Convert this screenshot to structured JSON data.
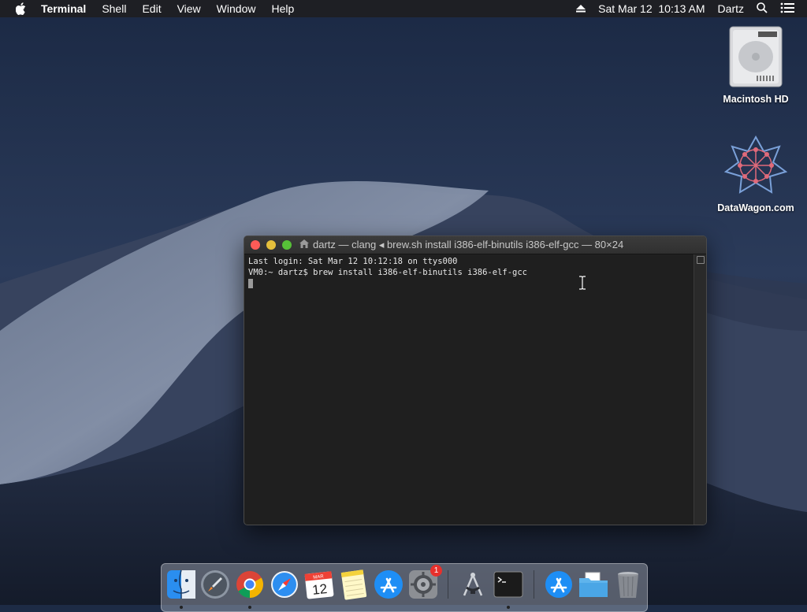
{
  "menubar": {
    "app_name": "Terminal",
    "items": [
      "Shell",
      "Edit",
      "View",
      "Window",
      "Help"
    ],
    "datetime": "Sat Mar 12  10:13 AM",
    "user": "Dartz"
  },
  "desktop_icons": [
    {
      "label": "Macintosh HD",
      "icon": "hard-drive-icon"
    },
    {
      "label": "DataWagon.com",
      "icon": "datawagon-logo-icon"
    }
  ],
  "terminal": {
    "title": "dartz — clang ◂ brew.sh install i386-elf-binutils i386-elf-gcc — 80×24",
    "lines": [
      "Last login: Sat Mar 12 10:12:18 on ttys000",
      "VM0:~ dartz$ brew install i386-elf-binutils i386-elf-gcc"
    ]
  },
  "dock": {
    "items": [
      {
        "name": "finder",
        "running": true
      },
      {
        "name": "launchpad",
        "running": false
      },
      {
        "name": "chrome",
        "running": true
      },
      {
        "name": "safari",
        "running": false
      },
      {
        "name": "calendar",
        "month": "MAR",
        "day": "12",
        "running": false
      },
      {
        "name": "notes",
        "running": false
      },
      {
        "name": "app-store",
        "running": false
      },
      {
        "name": "system-preferences",
        "badge": "1",
        "running": false
      },
      {
        "name": "instruments",
        "running": false
      },
      {
        "name": "terminal",
        "running": true
      },
      {
        "name": "app-store-downloads",
        "running": false
      },
      {
        "name": "documents-folder",
        "running": false
      },
      {
        "name": "trash",
        "running": false
      }
    ]
  }
}
